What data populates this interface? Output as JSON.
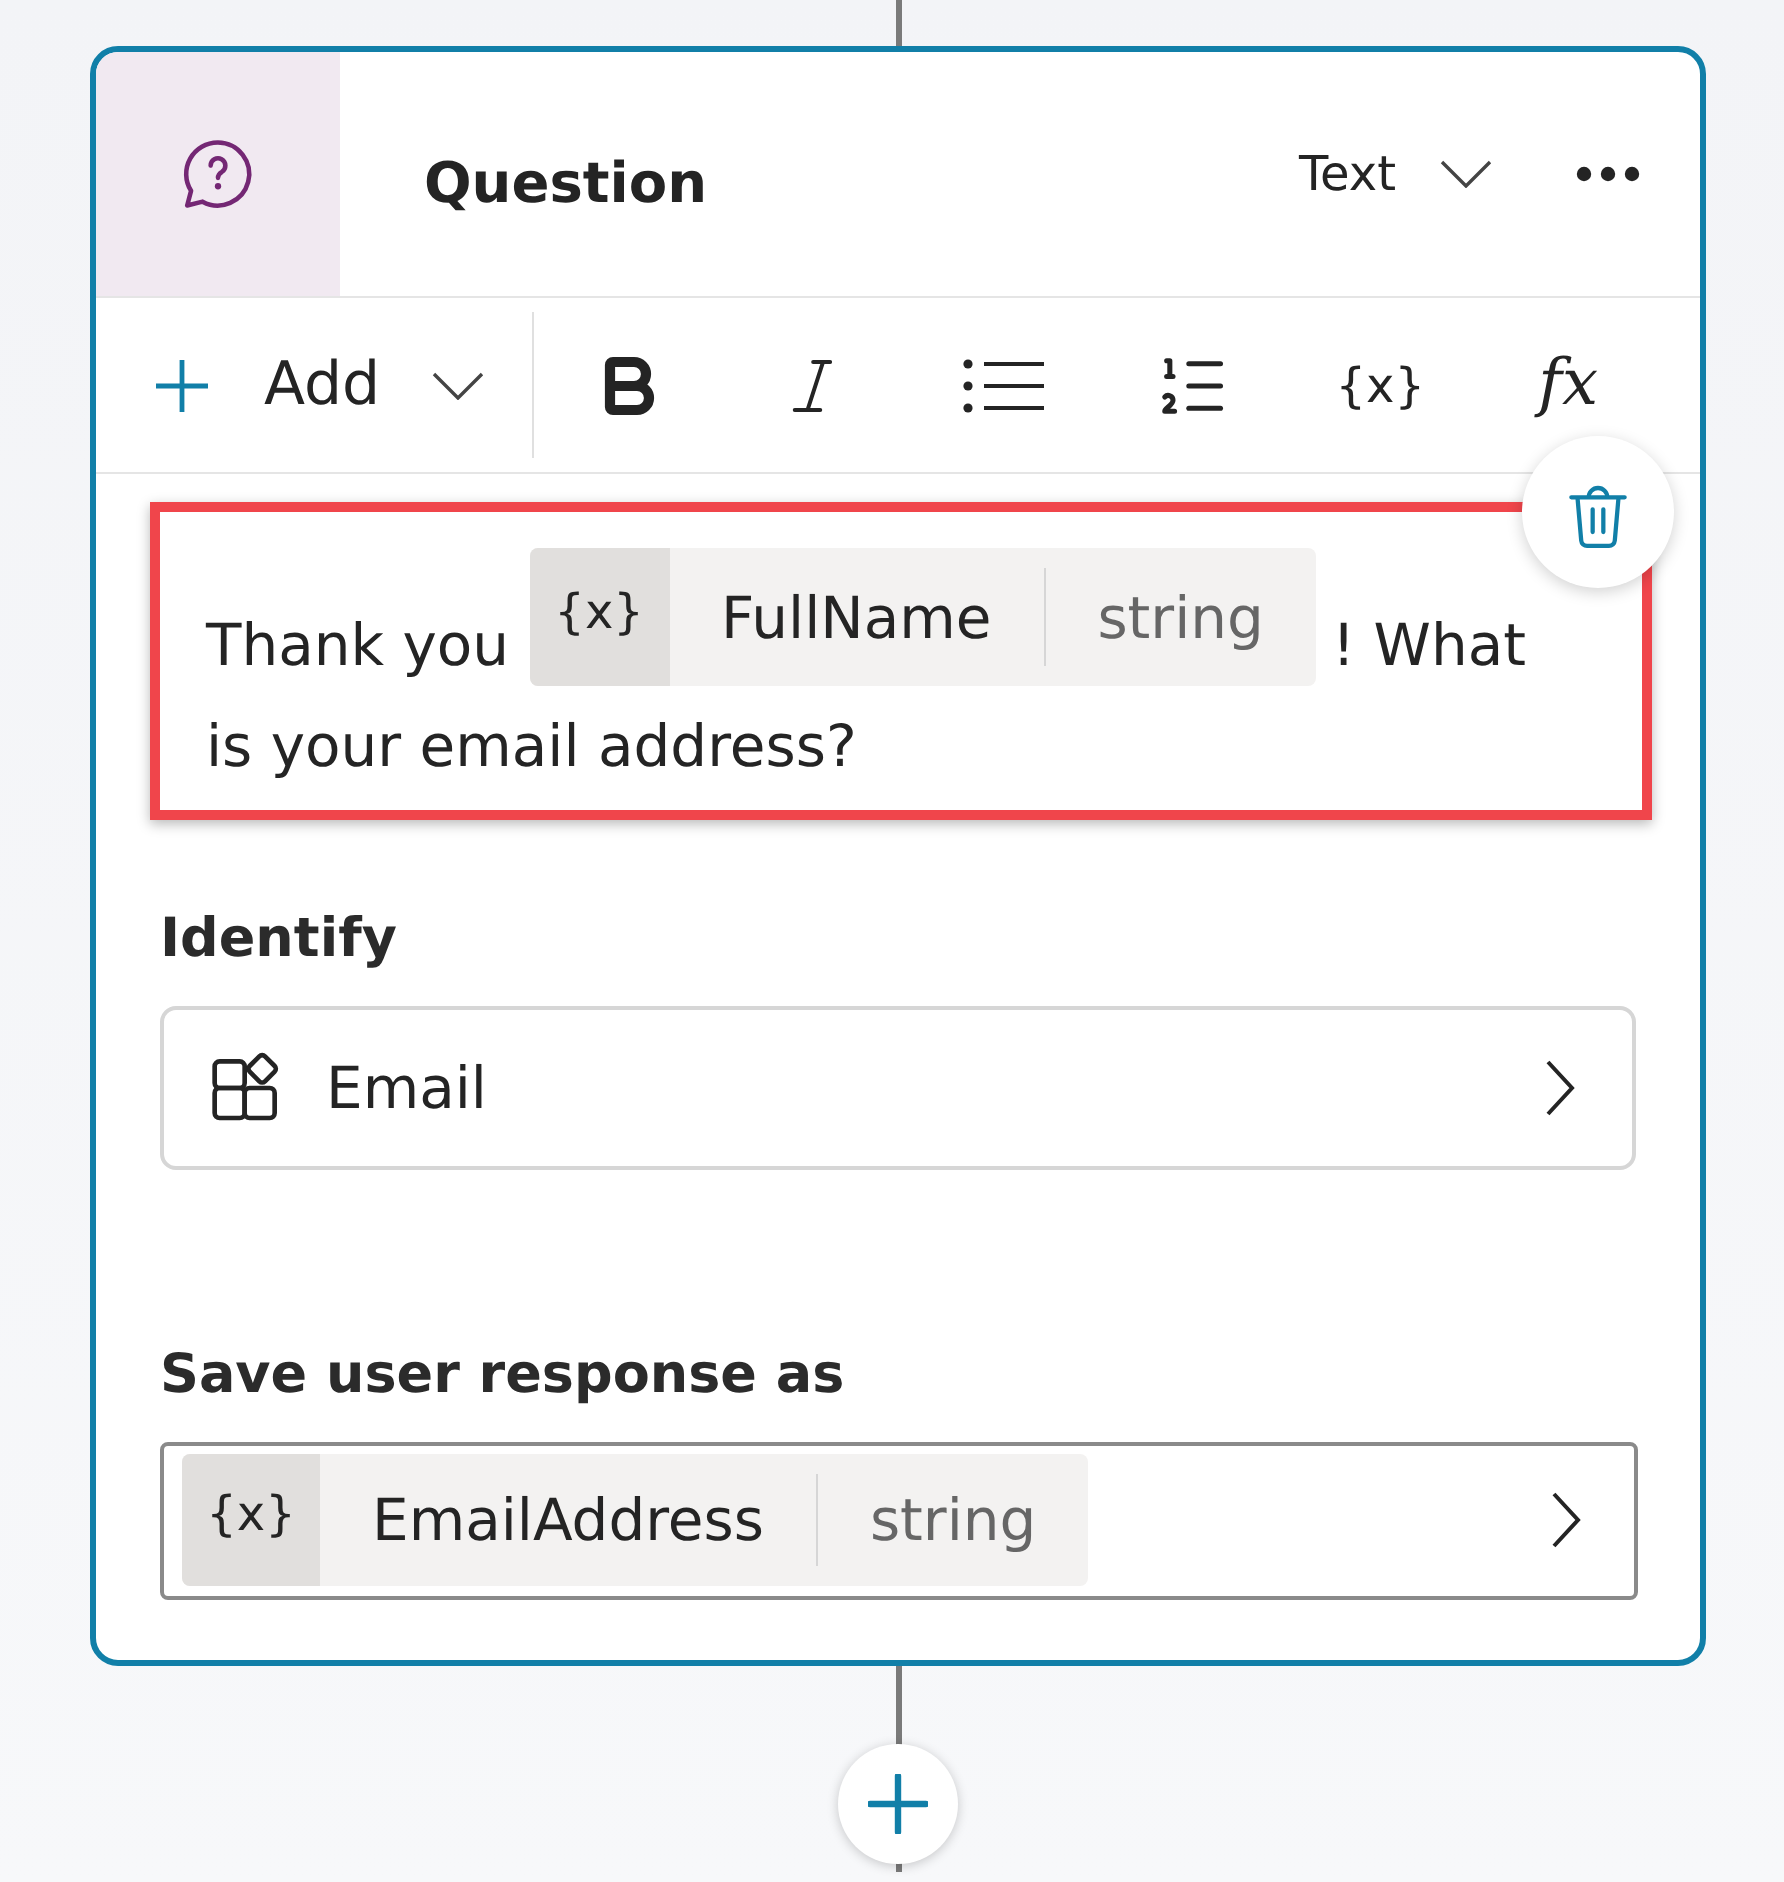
{
  "node": {
    "title": "Question",
    "response_type": "Text"
  },
  "toolbar": {
    "add_label": "Add",
    "variable_button": "{x}",
    "formula_button": "fx"
  },
  "message": {
    "highlighted": true,
    "parts": [
      {
        "kind": "text",
        "text": "Thank you"
      },
      {
        "kind": "variable",
        "icon": "{x}",
        "name": "FullName",
        "type": "string"
      },
      {
        "kind": "text",
        "text": "! What"
      },
      {
        "kind": "text",
        "text": "is your email address?"
      }
    ]
  },
  "identify": {
    "label": "Identify",
    "value": "Email"
  },
  "save_response": {
    "label": "Save user response as",
    "variable": {
      "icon": "{x}",
      "name": "EmailAddress",
      "type": "string"
    }
  }
}
